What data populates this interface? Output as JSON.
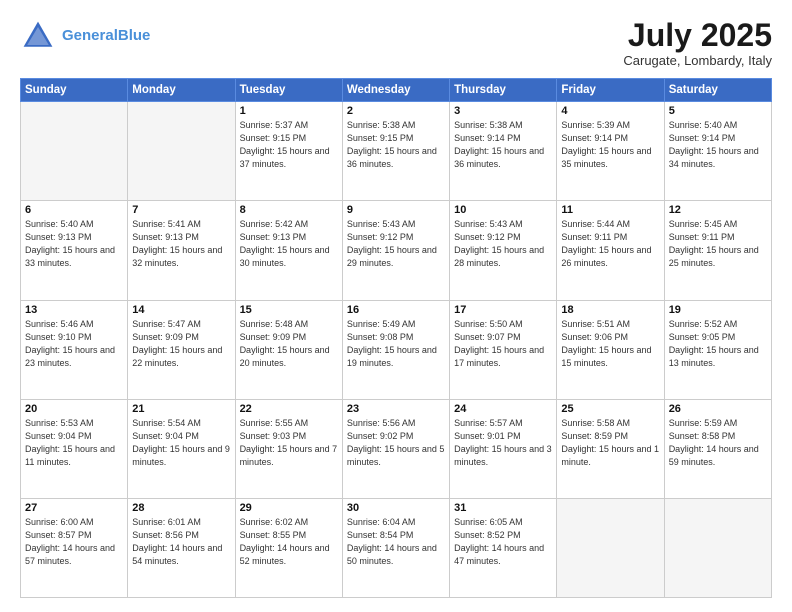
{
  "header": {
    "logo_line1": "General",
    "logo_line2": "Blue",
    "month": "July 2025",
    "location": "Carugate, Lombardy, Italy"
  },
  "weekdays": [
    "Sunday",
    "Monday",
    "Tuesday",
    "Wednesday",
    "Thursday",
    "Friday",
    "Saturday"
  ],
  "weeks": [
    [
      {
        "day": "",
        "info": ""
      },
      {
        "day": "",
        "info": ""
      },
      {
        "day": "1",
        "info": "Sunrise: 5:37 AM\nSunset: 9:15 PM\nDaylight: 15 hours\nand 37 minutes."
      },
      {
        "day": "2",
        "info": "Sunrise: 5:38 AM\nSunset: 9:15 PM\nDaylight: 15 hours\nand 36 minutes."
      },
      {
        "day": "3",
        "info": "Sunrise: 5:38 AM\nSunset: 9:14 PM\nDaylight: 15 hours\nand 36 minutes."
      },
      {
        "day": "4",
        "info": "Sunrise: 5:39 AM\nSunset: 9:14 PM\nDaylight: 15 hours\nand 35 minutes."
      },
      {
        "day": "5",
        "info": "Sunrise: 5:40 AM\nSunset: 9:14 PM\nDaylight: 15 hours\nand 34 minutes."
      }
    ],
    [
      {
        "day": "6",
        "info": "Sunrise: 5:40 AM\nSunset: 9:13 PM\nDaylight: 15 hours\nand 33 minutes."
      },
      {
        "day": "7",
        "info": "Sunrise: 5:41 AM\nSunset: 9:13 PM\nDaylight: 15 hours\nand 32 minutes."
      },
      {
        "day": "8",
        "info": "Sunrise: 5:42 AM\nSunset: 9:13 PM\nDaylight: 15 hours\nand 30 minutes."
      },
      {
        "day": "9",
        "info": "Sunrise: 5:43 AM\nSunset: 9:12 PM\nDaylight: 15 hours\nand 29 minutes."
      },
      {
        "day": "10",
        "info": "Sunrise: 5:43 AM\nSunset: 9:12 PM\nDaylight: 15 hours\nand 28 minutes."
      },
      {
        "day": "11",
        "info": "Sunrise: 5:44 AM\nSunset: 9:11 PM\nDaylight: 15 hours\nand 26 minutes."
      },
      {
        "day": "12",
        "info": "Sunrise: 5:45 AM\nSunset: 9:11 PM\nDaylight: 15 hours\nand 25 minutes."
      }
    ],
    [
      {
        "day": "13",
        "info": "Sunrise: 5:46 AM\nSunset: 9:10 PM\nDaylight: 15 hours\nand 23 minutes."
      },
      {
        "day": "14",
        "info": "Sunrise: 5:47 AM\nSunset: 9:09 PM\nDaylight: 15 hours\nand 22 minutes."
      },
      {
        "day": "15",
        "info": "Sunrise: 5:48 AM\nSunset: 9:09 PM\nDaylight: 15 hours\nand 20 minutes."
      },
      {
        "day": "16",
        "info": "Sunrise: 5:49 AM\nSunset: 9:08 PM\nDaylight: 15 hours\nand 19 minutes."
      },
      {
        "day": "17",
        "info": "Sunrise: 5:50 AM\nSunset: 9:07 PM\nDaylight: 15 hours\nand 17 minutes."
      },
      {
        "day": "18",
        "info": "Sunrise: 5:51 AM\nSunset: 9:06 PM\nDaylight: 15 hours\nand 15 minutes."
      },
      {
        "day": "19",
        "info": "Sunrise: 5:52 AM\nSunset: 9:05 PM\nDaylight: 15 hours\nand 13 minutes."
      }
    ],
    [
      {
        "day": "20",
        "info": "Sunrise: 5:53 AM\nSunset: 9:04 PM\nDaylight: 15 hours\nand 11 minutes."
      },
      {
        "day": "21",
        "info": "Sunrise: 5:54 AM\nSunset: 9:04 PM\nDaylight: 15 hours\nand 9 minutes."
      },
      {
        "day": "22",
        "info": "Sunrise: 5:55 AM\nSunset: 9:03 PM\nDaylight: 15 hours\nand 7 minutes."
      },
      {
        "day": "23",
        "info": "Sunrise: 5:56 AM\nSunset: 9:02 PM\nDaylight: 15 hours\nand 5 minutes."
      },
      {
        "day": "24",
        "info": "Sunrise: 5:57 AM\nSunset: 9:01 PM\nDaylight: 15 hours\nand 3 minutes."
      },
      {
        "day": "25",
        "info": "Sunrise: 5:58 AM\nSunset: 8:59 PM\nDaylight: 15 hours\nand 1 minute."
      },
      {
        "day": "26",
        "info": "Sunrise: 5:59 AM\nSunset: 8:58 PM\nDaylight: 14 hours\nand 59 minutes."
      }
    ],
    [
      {
        "day": "27",
        "info": "Sunrise: 6:00 AM\nSunset: 8:57 PM\nDaylight: 14 hours\nand 57 minutes."
      },
      {
        "day": "28",
        "info": "Sunrise: 6:01 AM\nSunset: 8:56 PM\nDaylight: 14 hours\nand 54 minutes."
      },
      {
        "day": "29",
        "info": "Sunrise: 6:02 AM\nSunset: 8:55 PM\nDaylight: 14 hours\nand 52 minutes."
      },
      {
        "day": "30",
        "info": "Sunrise: 6:04 AM\nSunset: 8:54 PM\nDaylight: 14 hours\nand 50 minutes."
      },
      {
        "day": "31",
        "info": "Sunrise: 6:05 AM\nSunset: 8:52 PM\nDaylight: 14 hours\nand 47 minutes."
      },
      {
        "day": "",
        "info": ""
      },
      {
        "day": "",
        "info": ""
      }
    ]
  ]
}
